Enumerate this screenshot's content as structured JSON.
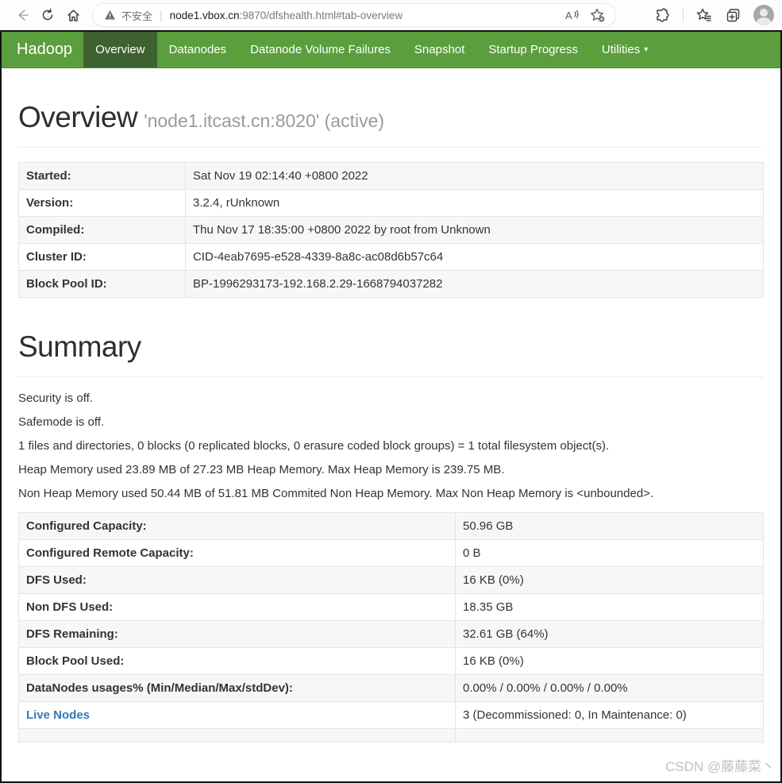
{
  "browser": {
    "security_label": "不安全",
    "url_host": "node1.vbox.cn",
    "url_rest": ":9870/dfshealth.html#tab-overview"
  },
  "navbar": {
    "brand": "Hadoop",
    "items": [
      {
        "label": "Overview",
        "active": true
      },
      {
        "label": "Datanodes"
      },
      {
        "label": "Datanode Volume Failures"
      },
      {
        "label": "Snapshot"
      },
      {
        "label": "Startup Progress"
      },
      {
        "label": "Utilities",
        "dropdown": true
      }
    ]
  },
  "overview": {
    "title": "Overview",
    "subtitle": "'node1.itcast.cn:8020' (active)",
    "table": [
      {
        "label": "Started:",
        "value": "Sat Nov 19 02:14:40 +0800 2022"
      },
      {
        "label": "Version:",
        "value": "3.2.4, rUnknown"
      },
      {
        "label": "Compiled:",
        "value": "Thu Nov 17 18:35:00 +0800 2022 by root from Unknown"
      },
      {
        "label": "Cluster ID:",
        "value": "CID-4eab7695-e528-4339-8a8c-ac08d6b57c64"
      },
      {
        "label": "Block Pool ID:",
        "value": "BP-1996293173-192.168.2.29-1668794037282"
      }
    ]
  },
  "summary": {
    "title": "Summary",
    "paragraphs": [
      "Security is off.",
      "Safemode is off.",
      "1 files and directories, 0 blocks (0 replicated blocks, 0 erasure coded block groups) = 1 total filesystem object(s).",
      "Heap Memory used 23.89 MB of 27.23 MB Heap Memory. Max Heap Memory is 239.75 MB.",
      "Non Heap Memory used 50.44 MB of 51.81 MB Commited Non Heap Memory. Max Non Heap Memory is <unbounded>."
    ],
    "table": [
      {
        "label": "Configured Capacity:",
        "value": "50.96 GB"
      },
      {
        "label": "Configured Remote Capacity:",
        "value": "0 B"
      },
      {
        "label": "DFS Used:",
        "value": "16 KB (0%)"
      },
      {
        "label": "Non DFS Used:",
        "value": "18.35 GB"
      },
      {
        "label": "DFS Remaining:",
        "value": "32.61 GB (64%)"
      },
      {
        "label": "Block Pool Used:",
        "value": "16 KB (0%)"
      },
      {
        "label": "DataNodes usages% (Min/Median/Max/stdDev):",
        "value": "0.00% / 0.00% / 0.00% / 0.00%"
      },
      {
        "label": "Live Nodes",
        "value": "3 (Decommissioned: 0, In Maintenance: 0)",
        "link": true
      }
    ]
  },
  "watermark": "CSDN @藤藤菜丶",
  "colors": {
    "navbar_green": "#5b9e3e",
    "navbar_active_green": "#3e6132",
    "link_blue": "#337ab7"
  }
}
